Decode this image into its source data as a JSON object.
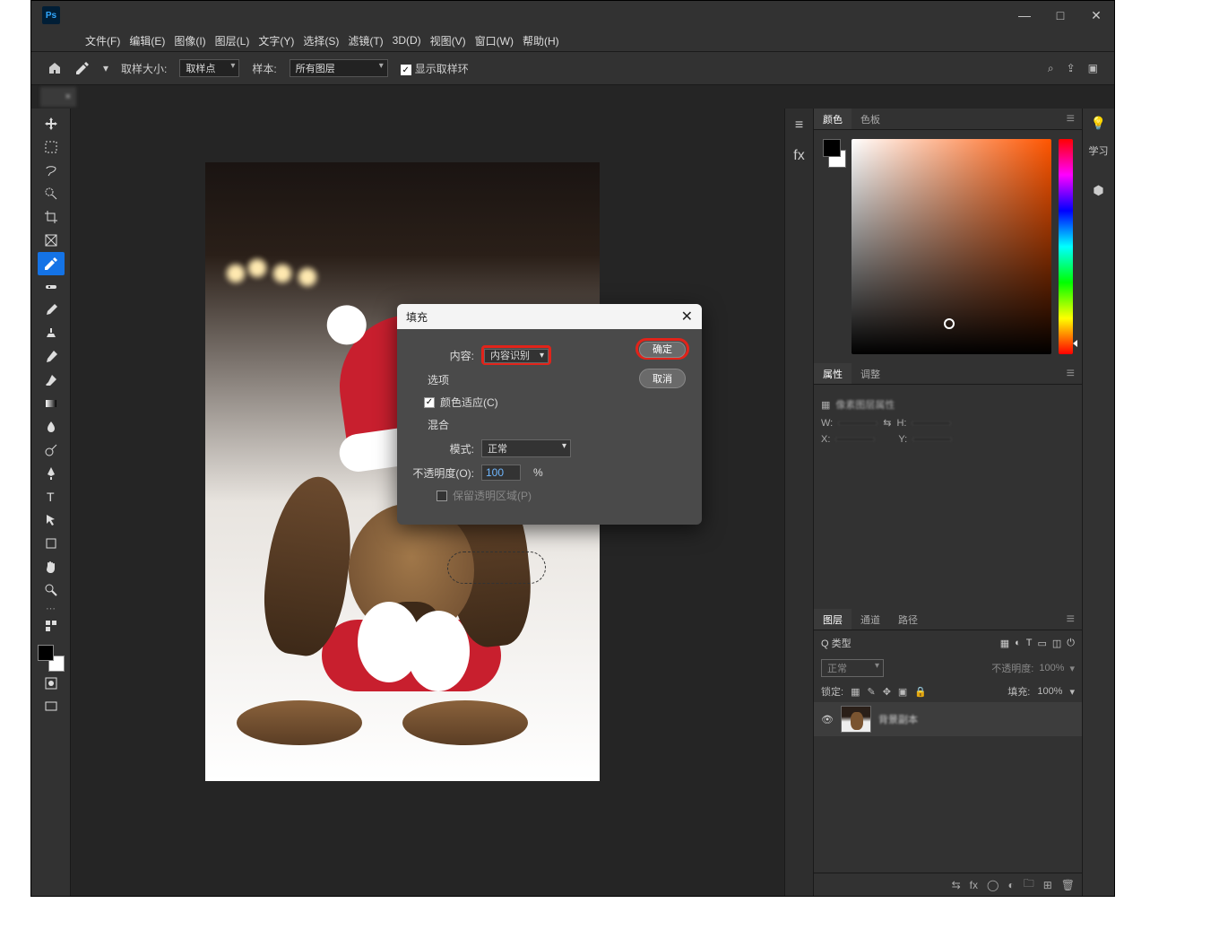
{
  "window": {
    "min": "—",
    "max": "□",
    "close": "✕"
  },
  "menus": [
    "文件(F)",
    "编辑(E)",
    "图像(I)",
    "图层(L)",
    "文字(Y)",
    "选择(S)",
    "滤镜(T)",
    "3D(D)",
    "视图(V)",
    "窗口(W)",
    "帮助(H)"
  ],
  "options": {
    "sample_label": "取样大小:",
    "sample_value": "取样点",
    "sample_from_label": "样本:",
    "sample_from_value": "所有图层",
    "show_ring": "显示取样环"
  },
  "doc_tab": {
    "name": "                    ",
    "x": "×"
  },
  "dialog": {
    "title": "填充",
    "content_label": "内容:",
    "content_value": "内容识别",
    "ok": "确定",
    "cancel": "取消",
    "options_label": "选项",
    "color_adapt": "颜色适应(C)",
    "blend_label": "混合",
    "mode_label": "模式:",
    "mode_value": "正常",
    "opacity_label": "不透明度(O):",
    "opacity_value": "100",
    "opacity_pct": "%",
    "preserve_trans": "保留透明区域(P)"
  },
  "panels": {
    "color_tab": "颜色",
    "swatch_tab": "色板",
    "props_tab": "属性",
    "adjust_tab": "调整",
    "props_title": "像素图层属性",
    "w_label": "W:",
    "h_label": "H:",
    "x_label": "X:",
    "y_label": "Y:",
    "layers_tab": "图层",
    "channels_tab": "通道",
    "paths_tab": "路径",
    "kind_label": "Q 类型",
    "blend_mode": "正常",
    "opacity_label": "不透明度:",
    "opacity_val": "100%",
    "lock_label": "锁定:",
    "fill_label": "填充:",
    "fill_val": "100%",
    "layer_name": "背景副本"
  },
  "rstrip": {
    "learn": "学习"
  }
}
